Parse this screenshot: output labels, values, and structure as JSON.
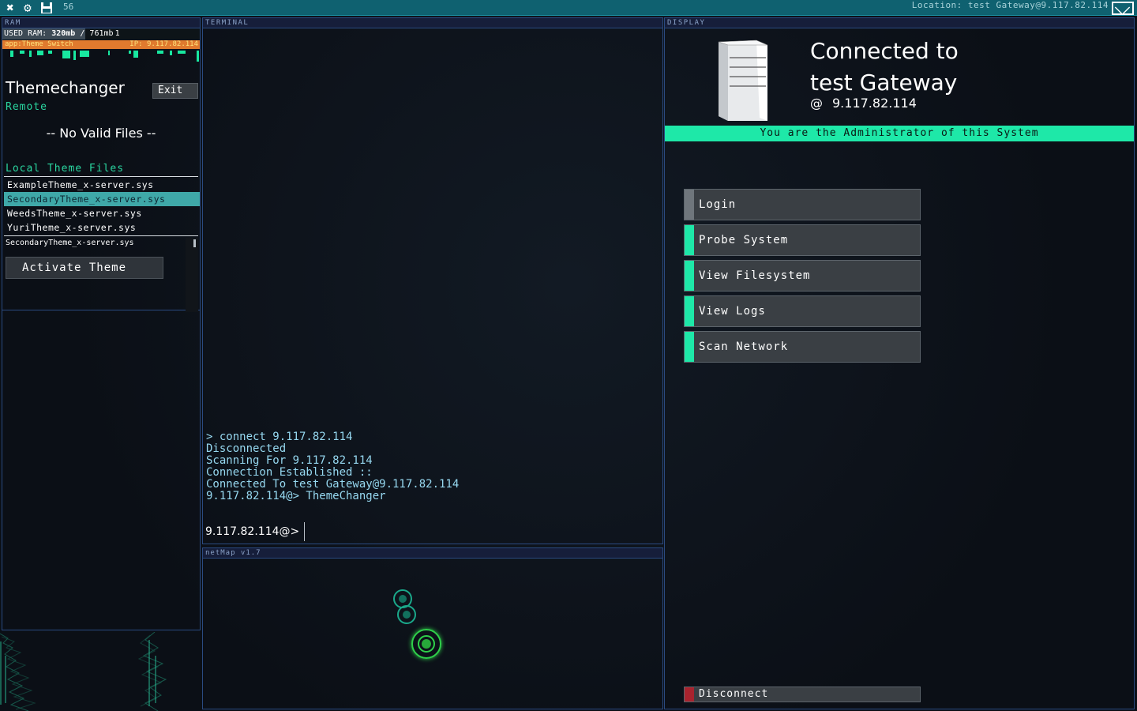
{
  "topbar": {
    "counter": "56",
    "location": "Location: test Gateway@9.117.82.114"
  },
  "ram": {
    "header": "RAM",
    "label": "USED RAM:",
    "used": "320mb",
    "separator": "/",
    "total": "761mb",
    "process_count": "1",
    "used_fraction": 0.42
  },
  "theme_app": {
    "bar_name": "app:Theme Switch",
    "bar_ip": "IP: 9.117.82.114",
    "title": "Themechanger",
    "exit_label": "Exit",
    "remote_label": "Remote",
    "no_files": "-- No Valid Files --",
    "local_label": "Local Theme Files",
    "files": [
      "ExampleTheme_x-server.sys",
      "SecondaryTheme_x-server.sys",
      "WeedsTheme_x-server.sys",
      "YuriTheme_x-server.sys"
    ],
    "selected_index": 1,
    "selected_file": "SecondaryTheme_x-server.sys",
    "activate_label": "Activate Theme"
  },
  "terminal": {
    "header": "TERMINAL",
    "lines": [
      "> connect 9.117.82.114",
      "Disconnected",
      "Scanning For 9.117.82.114",
      "Connection Established ::",
      "Connected To test Gateway@9.117.82.114",
      "9.117.82.114@> ThemeChanger"
    ],
    "prompt": "9.117.82.114@>"
  },
  "netmap": {
    "header": "netMap v1.7"
  },
  "display": {
    "header": "DISPLAY",
    "title_line1": "Connected to",
    "title_line2": "test Gateway",
    "at": "@",
    "ip": "9.117.82.114",
    "admin_message": "You are the Administrator of this System",
    "actions": [
      "Login",
      "Probe System",
      "View Filesystem",
      "View Logs",
      "Scan Network"
    ],
    "disconnect_label": "Disconnect"
  },
  "colors": {
    "accent": "#1ee8a8",
    "topbar": "#0f6170",
    "panel_border": "#2a4a80",
    "app_bar": "#e07a2e",
    "danger": "#a8232e"
  },
  "icons": [
    "close-icon",
    "settings-gear-icon",
    "save-disk-icon",
    "mail-icon",
    "server-tower-icon"
  ]
}
